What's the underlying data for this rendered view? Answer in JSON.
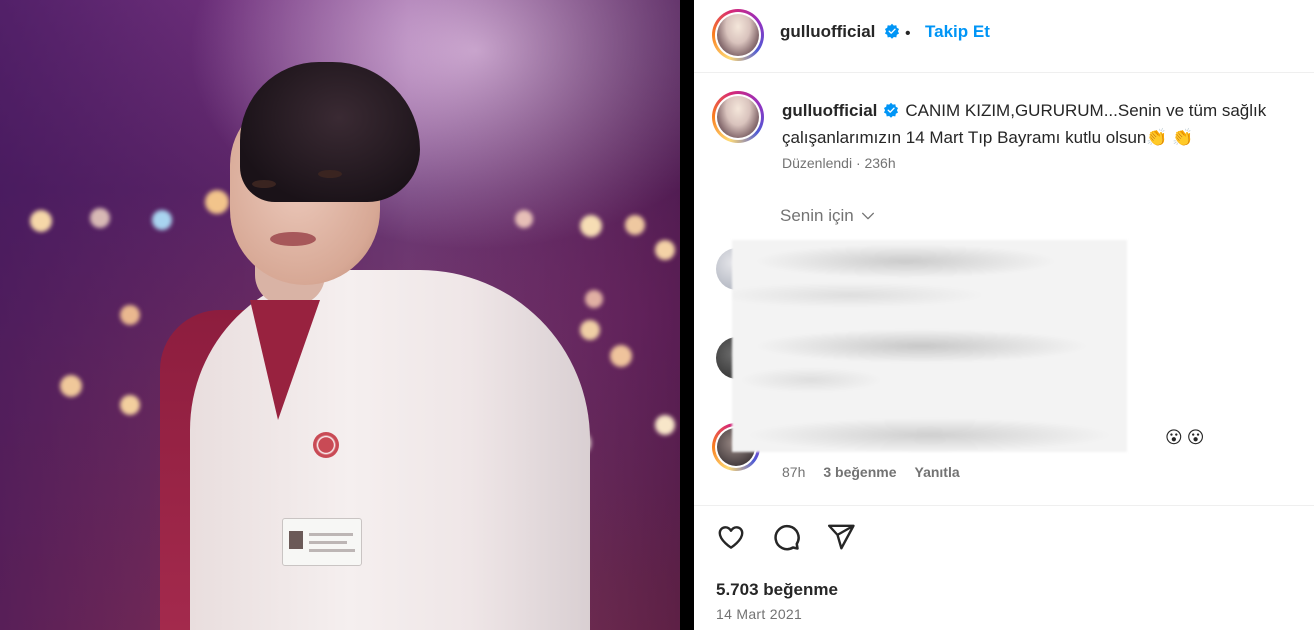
{
  "post": {
    "author": "gulluofficial",
    "follow_label": "Takip Et",
    "separator": "•"
  },
  "caption": {
    "author": "gulluofficial",
    "text": "CANIM KIZIM,GURURUM...Senin ve tüm sağlık çalışanlarımızın 14 Mart Tıp Bayramı kutlu olsun👏 👏",
    "meta": "Düzenlendi · 236h"
  },
  "comments_filter": {
    "label": "Senin için"
  },
  "comment_3": {
    "emojis": "😮😮",
    "time": "87h",
    "likes": "3 beğenme",
    "reply": "Yanıtla"
  },
  "footer": {
    "likes": "5.703 beğenme",
    "date": "14 Mart 2021"
  },
  "icons": [
    "heart-icon",
    "comment-icon",
    "share-icon",
    "verified-icon",
    "chevron-down-icon"
  ],
  "colors": {
    "accent": "#0095f6",
    "text": "#262626",
    "muted": "#737373"
  }
}
